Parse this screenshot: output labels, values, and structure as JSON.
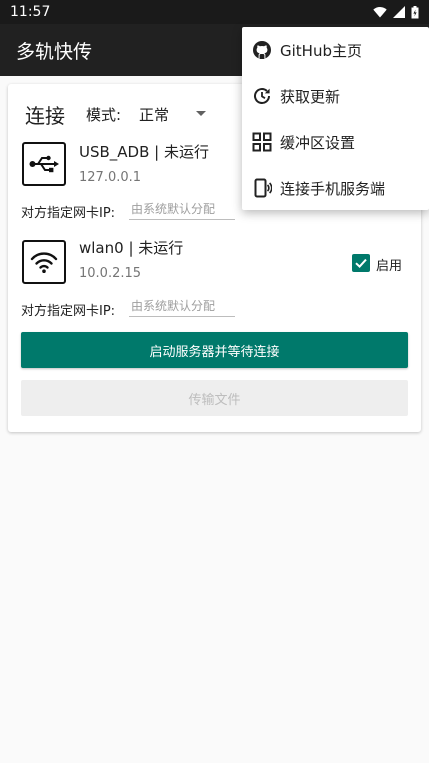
{
  "status_bar": {
    "time": "11:57",
    "icons": [
      "wifi-icon",
      "signal-icon",
      "battery-icon"
    ]
  },
  "app_bar": {
    "title": "多轨快传"
  },
  "connect": {
    "title": "连接",
    "mode_label": "模式:",
    "mode_value": "正常"
  },
  "interfaces": [
    {
      "icon": "usb-icon",
      "name": "USB_ADB | 未运行",
      "ip": "127.0.0.1",
      "nic_label": "对方指定网卡IP:",
      "nic_placeholder": "由系统默认分配"
    },
    {
      "icon": "wifi-icon",
      "name": "wlan0 | 未运行",
      "ip": "10.0.2.15",
      "nic_label": "对方指定网卡IP:",
      "nic_placeholder": "由系统默认分配",
      "enable_label": "启用",
      "enabled": true
    }
  ],
  "buttons": {
    "start": "启动服务器并等待连接",
    "transfer": "传输文件"
  },
  "menu": {
    "items": [
      {
        "icon": "github-icon",
        "label": "GitHub主页"
      },
      {
        "icon": "update-icon",
        "label": "获取更新"
      },
      {
        "icon": "grid-icon",
        "label": "缓冲区设置"
      },
      {
        "icon": "phone-connect-icon",
        "label": "连接手机服务端"
      }
    ]
  },
  "colors": {
    "accent": "#00796b",
    "app_bar": "#212121",
    "status_bar": "#1a1a1a"
  }
}
